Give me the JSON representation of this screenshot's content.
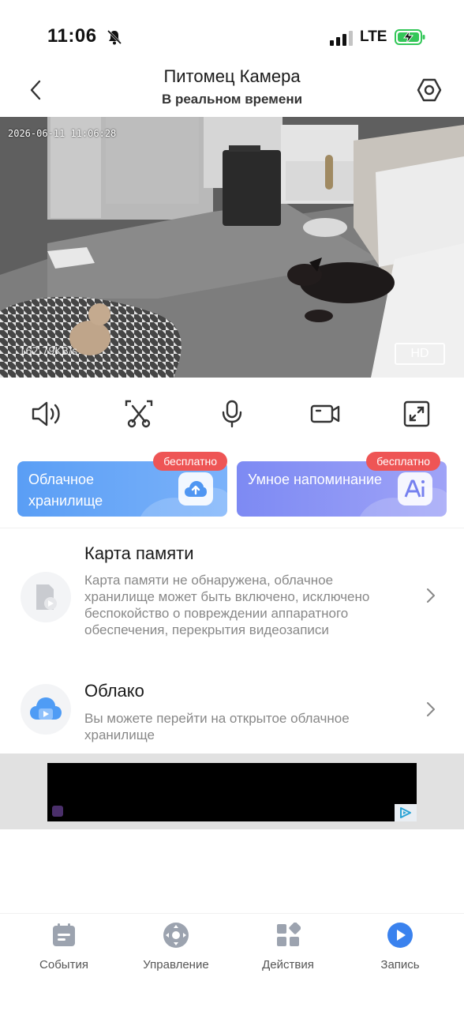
{
  "status_bar": {
    "time": "11:06",
    "network": "LTE"
  },
  "header": {
    "title": "Питомец Камера",
    "subtitle": "В реальном времени"
  },
  "video": {
    "timestamp": "2026-06-11  11:06:28",
    "bitrate": "162.79KB/s",
    "quality_label": "HD"
  },
  "controls": [
    "speaker-icon",
    "screenshot-icon",
    "microphone-icon",
    "record-video-icon",
    "fullscreen-icon"
  ],
  "promos": {
    "cloud": {
      "label": "Облачное хранилище",
      "badge": "бесплатно",
      "icon": "cloud-upload-icon",
      "color": "#5a9ef5"
    },
    "reminder": {
      "label": "Умное напоминание",
      "badge": "бесплатно",
      "icon": "ai-icon",
      "color": "#7d8af3"
    }
  },
  "list": {
    "memory_card": {
      "title": "Карта памяти",
      "description": "Карта памяти не обнаружена, облачное хранилище может быть включено, исключено беспокойство о повреждении аппаратного обеспечения, перекрытия видеозаписи"
    },
    "cloud": {
      "title": "Облако",
      "description": "Вы можете перейти на открытое облачное хранилище"
    }
  },
  "tabs": [
    {
      "label": "События",
      "icon": "events-icon"
    },
    {
      "label": "Управление",
      "icon": "control-icon"
    },
    {
      "label": "Действия",
      "icon": "actions-icon"
    },
    {
      "label": "Запись",
      "icon": "record-play-icon"
    }
  ],
  "colors": {
    "accent": "#3a82ee",
    "badge": "#ee5555",
    "icon_gray": "#9ca3af"
  }
}
